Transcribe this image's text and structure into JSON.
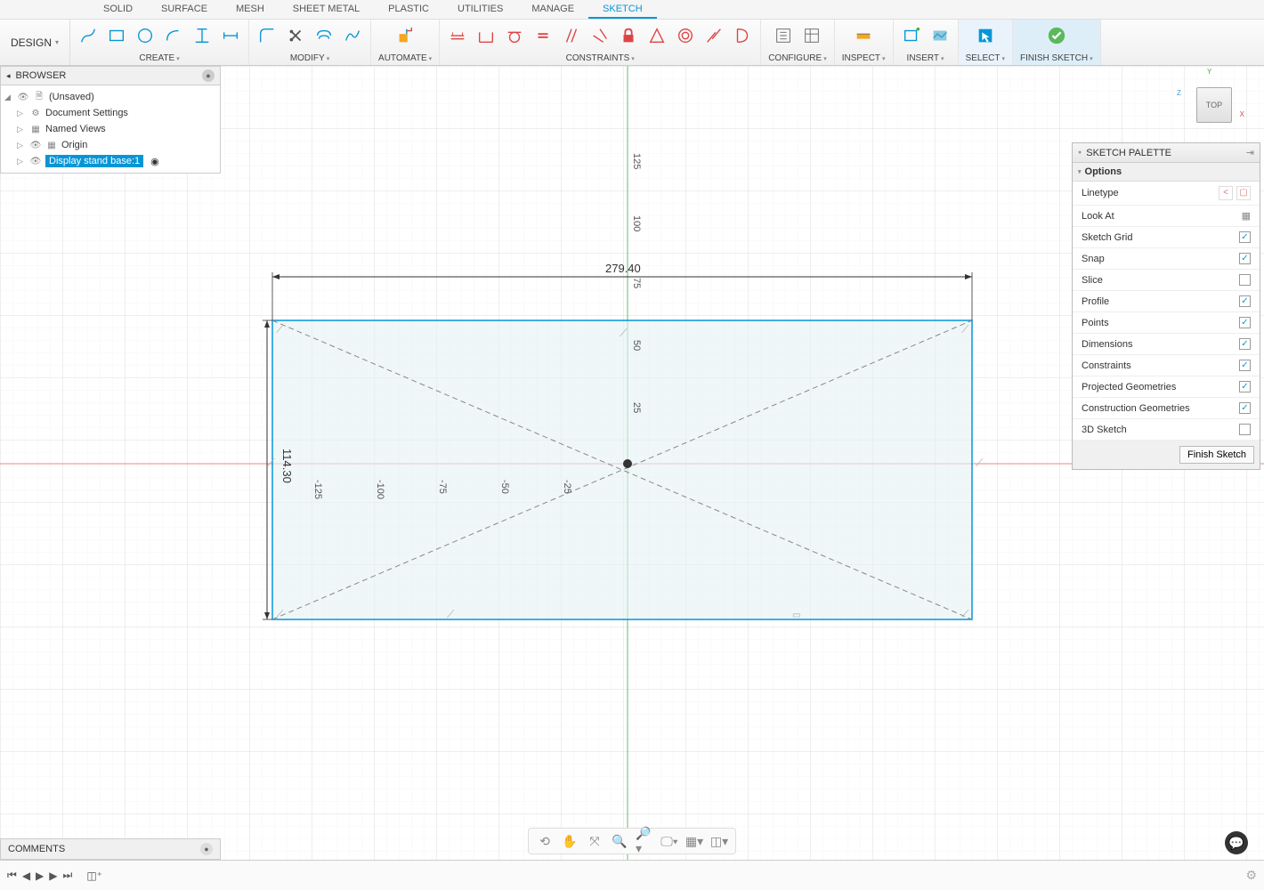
{
  "top_tabs": [
    "SOLID",
    "SURFACE",
    "MESH",
    "SHEET METAL",
    "PLASTIC",
    "UTILITIES",
    "MANAGE",
    "SKETCH"
  ],
  "active_tab": "SKETCH",
  "design_menu": "DESIGN",
  "ribbon_groups": {
    "create": "CREATE",
    "modify": "MODIFY",
    "automate": "AUTOMATE",
    "constraints": "CONSTRAINTS",
    "configure": "CONFIGURE",
    "inspect": "INSPECT",
    "insert": "INSERT",
    "select": "SELECT",
    "finish": "FINISH SKETCH"
  },
  "browser": {
    "title": "BROWSER",
    "root": "(Unsaved)",
    "items": [
      "Document Settings",
      "Named Views",
      "Origin",
      "Display stand base:1"
    ]
  },
  "view_cube": "TOP",
  "palette": {
    "title": "SKETCH PALETTE",
    "section": "Options",
    "rows": [
      {
        "label": "Linetype",
        "type": "linetype"
      },
      {
        "label": "Look At",
        "type": "icon"
      },
      {
        "label": "Sketch Grid",
        "type": "check",
        "checked": true
      },
      {
        "label": "Snap",
        "type": "check",
        "checked": true
      },
      {
        "label": "Slice",
        "type": "check",
        "checked": false
      },
      {
        "label": "Profile",
        "type": "check",
        "checked": true
      },
      {
        "label": "Points",
        "type": "check",
        "checked": true
      },
      {
        "label": "Dimensions",
        "type": "check",
        "checked": true
      },
      {
        "label": "Constraints",
        "type": "check",
        "checked": true
      },
      {
        "label": "Projected Geometries",
        "type": "check",
        "checked": true
      },
      {
        "label": "Construction Geometries",
        "type": "check",
        "checked": true
      },
      {
        "label": "3D Sketch",
        "type": "check",
        "checked": false
      }
    ],
    "finish_btn": "Finish Sketch"
  },
  "dimensions": {
    "width": "279.40",
    "height": "114.30"
  },
  "ruler_x": [
    "-125",
    "-100",
    "-75",
    "-50",
    "-25"
  ],
  "ruler_y": [
    "125",
    "100",
    "75",
    "50",
    "25"
  ],
  "comments": "COMMENTS"
}
